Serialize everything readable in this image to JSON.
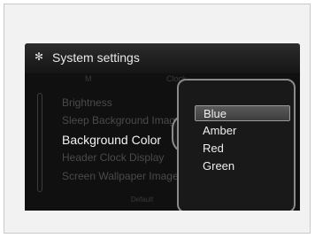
{
  "titlebar": {
    "title": "System settings",
    "icon": "gear-icon"
  },
  "menu": {
    "faded_tab_left": "M",
    "faded_tab_right": "Clock",
    "items": [
      {
        "label": "Brightness",
        "active": false
      },
      {
        "label": "Sleep Background Image",
        "active": false
      },
      {
        "label": "Background Color",
        "active": true
      },
      {
        "label": "Header Clock Display",
        "active": false
      },
      {
        "label": "Screen Wallpaper Image",
        "active": false
      }
    ],
    "bottom_tab": "Default"
  },
  "popup": {
    "options": [
      {
        "label": "Blue",
        "selected": true
      },
      {
        "label": "Amber",
        "selected": false
      },
      {
        "label": "Red",
        "selected": false
      },
      {
        "label": "Green",
        "selected": false
      }
    ]
  },
  "colors": {
    "screen_bg": "#101010",
    "popup_border": "#8a8a8a",
    "selection_bg": "#4a4a4a"
  }
}
